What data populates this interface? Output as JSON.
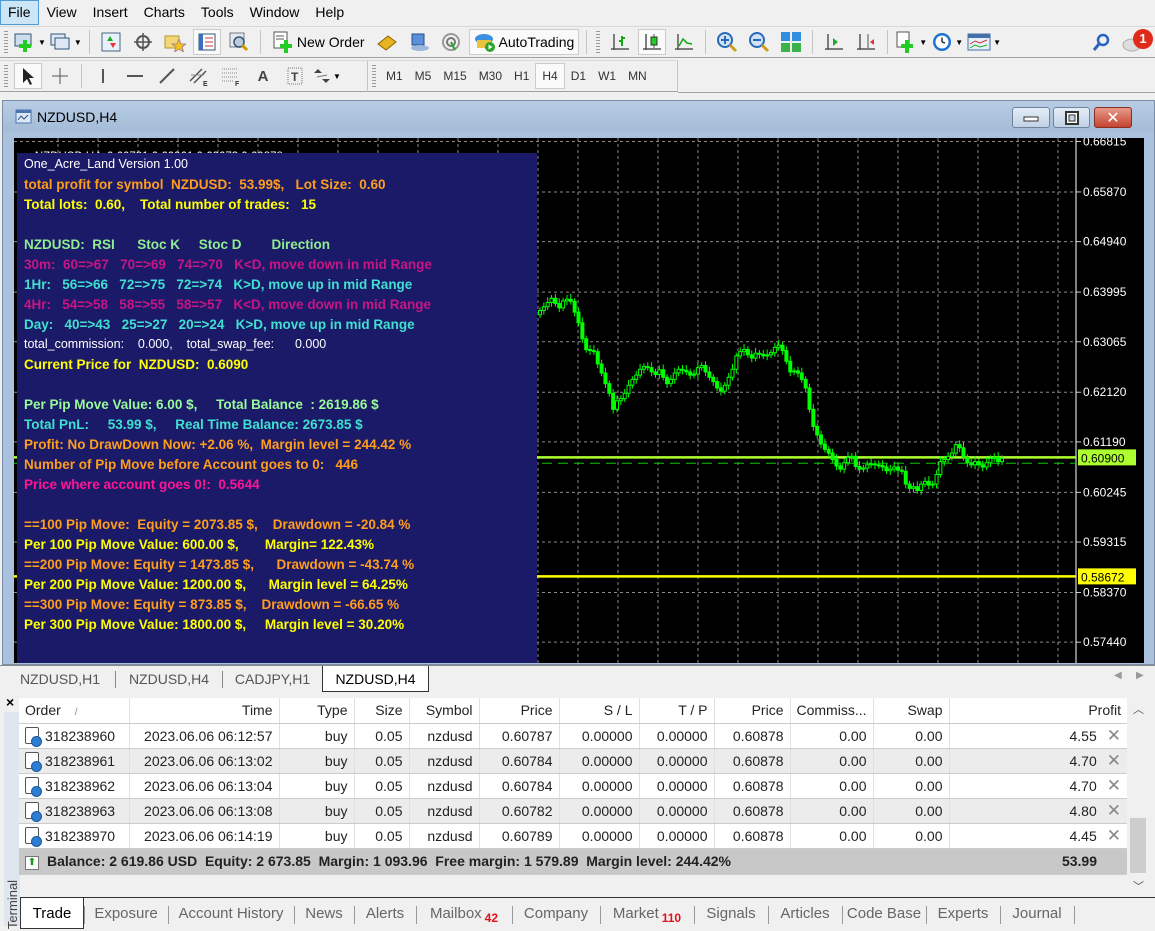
{
  "menu": [
    "File",
    "View",
    "Insert",
    "Charts",
    "Tools",
    "Window",
    "Help"
  ],
  "toolbar": {
    "new_order_label": "New Order",
    "autotrading_label": "AutoTrading",
    "notification_count": "1",
    "icons": [
      "new-chart-icon",
      "profiles-icon",
      "market-watch-icon",
      "crosshair-icon",
      "favorites-icon",
      "navigator-icon",
      "strategy-tester-icon",
      "new-order-icon",
      "metaeditor-icon",
      "signals-icon",
      "radio-icon",
      "autotrading-icon",
      "bar-chart-icon",
      "candlestick-icon",
      "line-chart-icon",
      "zoom-in-icon",
      "zoom-out-icon",
      "tile-windows-icon",
      "chart-shift-icon",
      "autoscroll-icon",
      "indicators-icon",
      "periods-icon",
      "templates-icon",
      "search-icon",
      "chat-icon"
    ]
  },
  "drawing_toolbar": {
    "icons": [
      "cursor-icon",
      "crosshair-icon",
      "vertical-line-icon",
      "horizontal-line-icon",
      "trendline-icon",
      "equidistant-channel-icon",
      "fibonacci-icon",
      "text-icon",
      "text-label-icon",
      "arrows-icon"
    ],
    "text_tool": "A",
    "timeframes": [
      "M1",
      "M5",
      "M15",
      "M30",
      "H1",
      "H4",
      "D1",
      "W1",
      "MN"
    ],
    "active_timeframe": "H4"
  },
  "chart_window": {
    "title": "NZDUSD,H4",
    "ohlc_header": "NZDUSD,H4  0.60731 0.60961 0.60673 0.60878",
    "info_lines": [
      {
        "text": "One_Acre_Land Version 1.00",
        "color": "#ffffff",
        "bold": false
      },
      {
        "text": "total profit for symbol  NZDUSD:  53.99$,   Lot Size:  0.60",
        "color": "#ff9d1c"
      },
      {
        "text": "Total lots:  0.60,    Total number of trades:   15",
        "color": "#ffff00"
      },
      {
        "text": "",
        "color": "#ffffff"
      },
      {
        "text": "NZDUSD:  RSI      Stoc K     Stoc D        Direction",
        "color": "#90ee90"
      },
      {
        "text": "30m:  60=>67   70=>69   74=>70   K<D, move down in mid Range",
        "color": "#c71585"
      },
      {
        "text": "1Hr:   56=>66   72=>75   72=>74   K>D, move up in mid Range",
        "color": "#40e0d0"
      },
      {
        "text": "4Hr:   54=>58   58=>55   58=>57   K<D, move down in mid Range",
        "color": "#c71585"
      },
      {
        "text": "Day:   40=>43   25=>27   20=>24   K>D, move up in mid Range",
        "color": "#40e0d0"
      },
      {
        "text": "total_commission:    0.000,    total_swap_fee:      0.000",
        "color": "#ffffff",
        "bold": false
      },
      {
        "text": "Current Price for  NZDUSD:  0.6090",
        "color": "#ffff00"
      },
      {
        "text": "",
        "color": "#ffffff"
      },
      {
        "text": "Per Pip Move Value: 6.00 $,     Total Balance  : 2619.86 $",
        "color": "#98fb98"
      },
      {
        "text": "Total PnL:     53.99 $,     Real Time Balance: 2673.85 $",
        "color": "#40e0d0"
      },
      {
        "text": "Profit: No DrawDown Now: +2.06 %,  Margin level = 244.42 %",
        "color": "#ff9d1c"
      },
      {
        "text": "Number of Pip Move before Account goes to 0:   446",
        "color": "#ff9d1c"
      },
      {
        "text": "Price where account goes 0!:  0.5644",
        "color": "#ff1493"
      },
      {
        "text": "",
        "color": "#ffffff"
      },
      {
        "text": "==100 Pip Move:  Equity = 2073.85 $,    Drawdown = -20.84 %",
        "color": "#ff9d1c"
      },
      {
        "text": "Per 100 Pip Move Value: 600.00 $,       Margin= 122.43%",
        "color": "#ffff00"
      },
      {
        "text": "==200 Pip Move: Equity = 1473.85 $,      Drawdown = -43.74 %",
        "color": "#ff9d1c"
      },
      {
        "text": "Per 200 Pip Move Value: 1200.00 $,      Margin level = 64.25%",
        "color": "#ffff00"
      },
      {
        "text": "==300 Pip Move: Equity = 873.85 $,    Drawdown = -66.65 %",
        "color": "#ff9d1c"
      },
      {
        "text": "Per 300 Pip Move Value: 1800.00 $,     Margin level = 30.20%",
        "color": "#ffff00"
      }
    ],
    "price_axis": [
      "0.66815",
      "0.65870",
      "0.64940",
      "0.63995",
      "0.63065",
      "0.62120",
      "0.61190",
      "0.60245",
      "0.59315",
      "0.58370",
      "0.57440"
    ],
    "current_price_label": "0.60900",
    "yellow_line_label": "0.58672",
    "colors": {
      "candle": "#00ff00",
      "price_line": "#adff2f",
      "level_line": "#ffff00",
      "panel_bg": "#1b1a68"
    }
  },
  "chart_data": {
    "type": "candlestick",
    "symbol": "NZDUSD",
    "timeframe": "H4",
    "ylim": [
      0.5705,
      0.6688
    ],
    "y_ticks": [
      0.66815,
      0.6587,
      0.6494,
      0.63995,
      0.63065,
      0.6212,
      0.6119,
      0.60245,
      0.59315,
      0.5837,
      0.5744
    ],
    "horizontal_lines": [
      {
        "price": 0.609,
        "label": "0.60900",
        "color": "#adff2f",
        "style": "solid"
      },
      {
        "price": 0.6079,
        "label": "",
        "color": "#00cc00",
        "style": "dashed"
      },
      {
        "price": 0.58672,
        "label": "0.58672",
        "color": "#ffff00",
        "style": "solid"
      }
    ],
    "closes": [
      0.6365,
      0.6372,
      0.638,
      0.6388,
      0.6378,
      0.637,
      0.6383,
      0.6386,
      0.6382,
      0.6362,
      0.6342,
      0.6312,
      0.6292,
      0.629,
      0.6288,
      0.6265,
      0.6248,
      0.6228,
      0.621,
      0.618,
      0.6196,
      0.62,
      0.621,
      0.6225,
      0.6236,
      0.6244,
      0.6255,
      0.626,
      0.6258,
      0.625,
      0.6245,
      0.6254,
      0.624,
      0.6228,
      0.6236,
      0.6248,
      0.6255,
      0.6253,
      0.625,
      0.6244,
      0.6246,
      0.6258,
      0.6262,
      0.625,
      0.624,
      0.6232,
      0.622,
      0.6214,
      0.6225,
      0.624,
      0.6255,
      0.628,
      0.6288,
      0.6292,
      0.6282,
      0.6276,
      0.6285,
      0.6283,
      0.628,
      0.6282,
      0.6286,
      0.6296,
      0.63,
      0.629,
      0.627,
      0.625,
      0.6252,
      0.6248,
      0.6236,
      0.622,
      0.618,
      0.6148,
      0.6132,
      0.6115,
      0.6105,
      0.6098,
      0.6086,
      0.6074,
      0.6068,
      0.608,
      0.609,
      0.6092,
      0.6073,
      0.6068,
      0.607,
      0.6076,
      0.6078,
      0.6076,
      0.6075,
      0.6072,
      0.6065,
      0.6068,
      0.6072,
      0.6066,
      0.6064,
      0.604,
      0.6032,
      0.6035,
      0.6028,
      0.604,
      0.6045,
      0.6038,
      0.604,
      0.6058,
      0.6082,
      0.6086,
      0.6092,
      0.6098,
      0.6114,
      0.6108,
      0.609,
      0.608,
      0.6076,
      0.6082,
      0.6076,
      0.6072,
      0.608,
      0.6088,
      0.609,
      0.6082,
      0.6088
    ]
  },
  "chart_tabs": [
    "NZDUSD,H1",
    "NZDUSD,H4",
    "CADJPY,H1",
    "NZDUSD,H4"
  ],
  "active_chart_tab": 3,
  "terminal": {
    "label": "Terminal",
    "columns": [
      "Order",
      "Time",
      "Type",
      "Size",
      "Symbol",
      "Price",
      "S / L",
      "T / P",
      "Price",
      "Commiss...",
      "Swap",
      "Profit"
    ],
    "sort_indicator": "/",
    "rows": [
      [
        "318238960",
        "2023.06.06 06:12:57",
        "buy",
        "0.05",
        "nzdusd",
        "0.60787",
        "0.00000",
        "0.00000",
        "0.60878",
        "0.00",
        "0.00",
        "4.55"
      ],
      [
        "318238961",
        "2023.06.06 06:13:02",
        "buy",
        "0.05",
        "nzdusd",
        "0.60784",
        "0.00000",
        "0.00000",
        "0.60878",
        "0.00",
        "0.00",
        "4.70"
      ],
      [
        "318238962",
        "2023.06.06 06:13:04",
        "buy",
        "0.05",
        "nzdusd",
        "0.60784",
        "0.00000",
        "0.00000",
        "0.60878",
        "0.00",
        "0.00",
        "4.70"
      ],
      [
        "318238963",
        "2023.06.06 06:13:08",
        "buy",
        "0.05",
        "nzdusd",
        "0.60782",
        "0.00000",
        "0.00000",
        "0.60878",
        "0.00",
        "0.00",
        "4.80"
      ],
      [
        "318238970",
        "2023.06.06 06:14:19",
        "buy",
        "0.05",
        "nzdusd",
        "0.60789",
        "0.00000",
        "0.00000",
        "0.60878",
        "0.00",
        "0.00",
        "4.45"
      ]
    ],
    "summary": "Balance: 2 619.86 USD  Equity: 2 673.85  Margin: 1 093.96  Free margin: 1 579.89  Margin level: 244.42%",
    "summary_profit": "53.99",
    "tabs": [
      {
        "label": "Trade"
      },
      {
        "label": "Exposure"
      },
      {
        "label": "Account History"
      },
      {
        "label": "News"
      },
      {
        "label": "Alerts"
      },
      {
        "label": "Mailbox",
        "badge": "42"
      },
      {
        "label": "Company"
      },
      {
        "label": "Market",
        "badge": "110"
      },
      {
        "label": "Signals"
      },
      {
        "label": "Articles"
      },
      {
        "label": "Code Base"
      },
      {
        "label": "Experts"
      },
      {
        "label": "Journal"
      }
    ],
    "active_tab": 0
  }
}
